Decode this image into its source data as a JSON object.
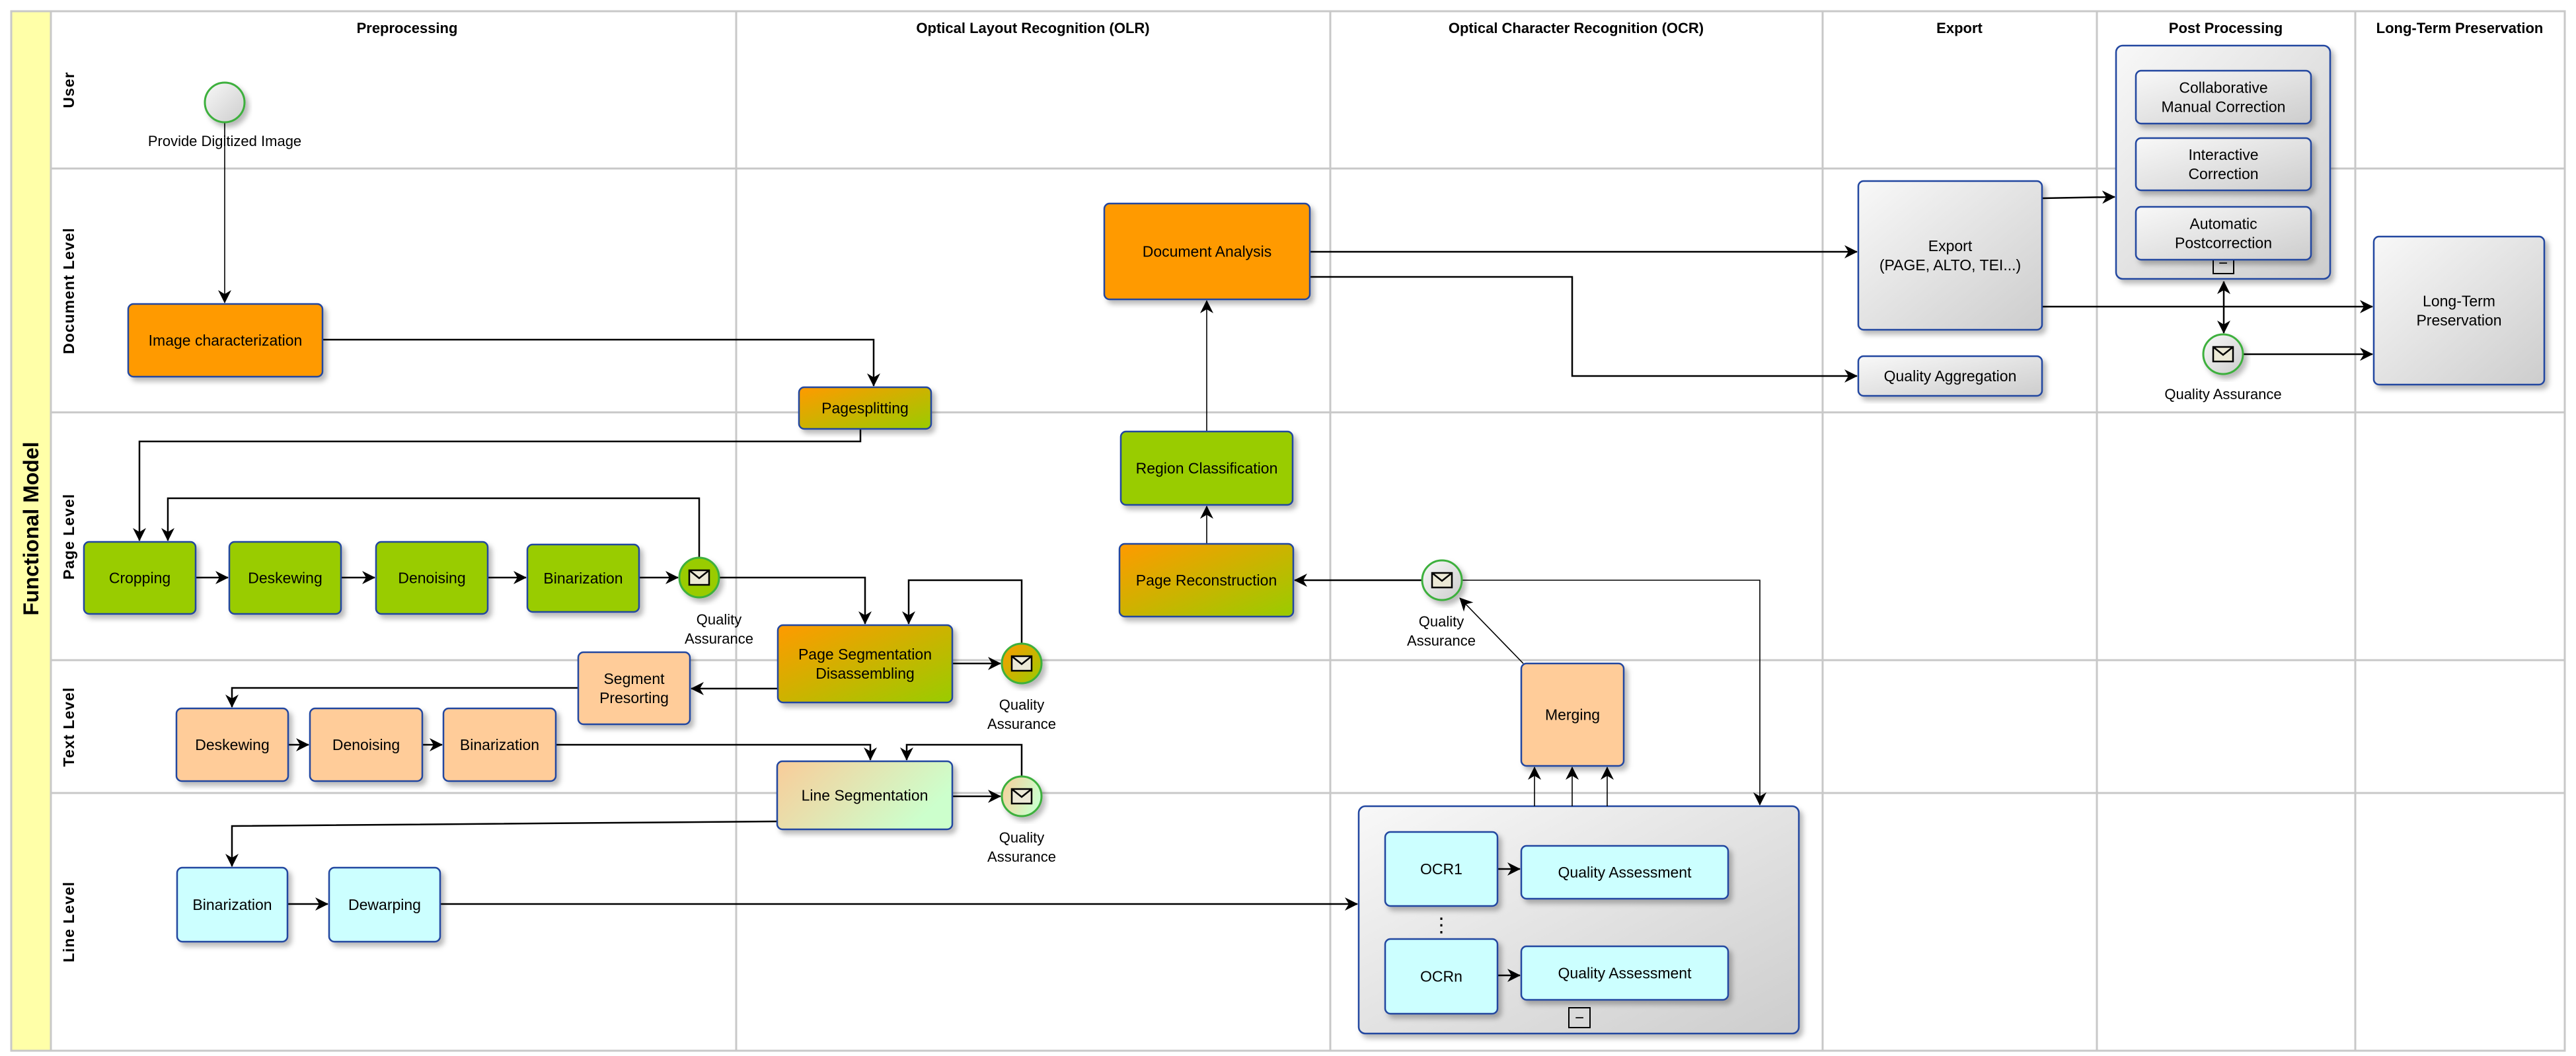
{
  "pool": {
    "title": "Functional Model",
    "band_color": "#ffffa8"
  },
  "columns": [
    {
      "id": "preprocessing",
      "label": "Preprocessing"
    },
    {
      "id": "olr",
      "label": "Optical Layout Recognition (OLR)"
    },
    {
      "id": "ocr",
      "label": "Optical Character Recognition (OCR)"
    },
    {
      "id": "export",
      "label": "Export"
    },
    {
      "id": "postprocessing",
      "label": "Post Processing"
    },
    {
      "id": "ltp",
      "label": "Long-Term Preservation"
    }
  ],
  "lanes": [
    {
      "id": "user",
      "label": "User"
    },
    {
      "id": "document",
      "label": "Document Level"
    },
    {
      "id": "page",
      "label": "Page Level"
    },
    {
      "id": "text",
      "label": "Text Level"
    },
    {
      "id": "line",
      "label": "Line Level"
    }
  ],
  "colors": {
    "orange": "#ff9a00",
    "green": "#99cc00",
    "peach": "#ffcc99",
    "cyan": "#ccffff",
    "gray_light": "#f5f5f5",
    "gray_dark": "#cfcfcf",
    "task_border": "#2346a0",
    "event_border": "#3db03d",
    "envelope_fill": "#ece9d6",
    "light_green": "#ccffcc"
  },
  "start_event": {
    "id": "start",
    "label": "Provide Digitized Image"
  },
  "tasks": [
    {
      "id": "image-characterization",
      "lines": [
        "Image characterization"
      ],
      "fill": "orange"
    },
    {
      "id": "pagesplitting",
      "lines": [
        "Pagesplitting"
      ],
      "fill": "orange-green"
    },
    {
      "id": "document-analysis",
      "lines": [
        "Document Analysis"
      ],
      "fill": "orange"
    },
    {
      "id": "region-classification",
      "lines": [
        "Region Classification"
      ],
      "fill": "green"
    },
    {
      "id": "page-reconstruction",
      "lines": [
        "Page Reconstruction"
      ],
      "fill": "orange-green"
    },
    {
      "id": "page-cropping",
      "lines": [
        "Cropping"
      ],
      "fill": "green"
    },
    {
      "id": "page-deskewing",
      "lines": [
        "Deskewing"
      ],
      "fill": "green"
    },
    {
      "id": "page-denoising",
      "lines": [
        "Denoising"
      ],
      "fill": "green"
    },
    {
      "id": "page-binarization",
      "lines": [
        "Binarization"
      ],
      "fill": "green"
    },
    {
      "id": "page-segmentation",
      "lines": [
        "Page Segmentation",
        "Disassembling"
      ],
      "fill": "orange-green"
    },
    {
      "id": "segment-presorting",
      "lines": [
        "Segment",
        "Presorting"
      ],
      "fill": "peach"
    },
    {
      "id": "text-deskewing",
      "lines": [
        "Deskewing"
      ],
      "fill": "peach"
    },
    {
      "id": "text-denoising",
      "lines": [
        "Denoising"
      ],
      "fill": "peach"
    },
    {
      "id": "text-binarization",
      "lines": [
        "Binarization"
      ],
      "fill": "peach"
    },
    {
      "id": "line-segmentation",
      "lines": [
        "Line Segmentation"
      ],
      "fill": "peach-lightgreen"
    },
    {
      "id": "merging",
      "lines": [
        "Merging"
      ],
      "fill": "peach"
    },
    {
      "id": "line-binarization",
      "lines": [
        "Binarization"
      ],
      "fill": "cyan"
    },
    {
      "id": "line-dewarping",
      "lines": [
        "Dewarping"
      ],
      "fill": "cyan"
    },
    {
      "id": "ocr1",
      "lines": [
        "OCR1"
      ],
      "fill": "cyan"
    },
    {
      "id": "quality-assessment-1",
      "lines": [
        "Quality Assessment"
      ],
      "fill": "cyan"
    },
    {
      "id": "ocrn",
      "lines": [
        "OCRn"
      ],
      "fill": "cyan"
    },
    {
      "id": "quality-assessment-n",
      "lines": [
        "Quality Assessment"
      ],
      "fill": "cyan"
    },
    {
      "id": "export",
      "lines": [
        "Export",
        "(PAGE, ALTO, TEI...)"
      ],
      "fill": "gray"
    },
    {
      "id": "quality-aggregation",
      "lines": [
        "Quality Aggregation"
      ],
      "fill": "gray"
    },
    {
      "id": "collaborative-correction",
      "lines": [
        "Collaborative",
        "Manual Correction"
      ],
      "fill": "gray"
    },
    {
      "id": "interactive-correction",
      "lines": [
        "Interactive",
        "Correction"
      ],
      "fill": "gray"
    },
    {
      "id": "automatic-postcorrection",
      "lines": [
        "Automatic",
        "Postcorrection"
      ],
      "fill": "gray"
    },
    {
      "id": "long-term-preservation",
      "lines": [
        "Long-Term",
        "Preservation"
      ],
      "fill": "gray"
    }
  ],
  "subprocesses": [
    {
      "id": "ocr-subprocess",
      "collapse_marker": "−"
    },
    {
      "id": "postprocessing-subprocess",
      "collapse_marker": "−"
    }
  ],
  "qa_events": [
    {
      "id": "qa-page",
      "lines": [
        "Quality",
        "Assurance"
      ],
      "fill": "green"
    },
    {
      "id": "qa-page-segmentation",
      "lines": [
        "Quality",
        "Assurance"
      ],
      "fill": "orange-green"
    },
    {
      "id": "qa-line-segmentation",
      "lines": [
        "Quality",
        "Assurance"
      ],
      "fill": "peach-lightgreen"
    },
    {
      "id": "qa-ocr",
      "lines": [
        "Quality",
        "Assurance"
      ],
      "fill": "gray"
    },
    {
      "id": "qa-postprocessing",
      "lines": [
        "Quality Assurance"
      ],
      "fill": "gray"
    }
  ],
  "ellipsis": "⋮"
}
